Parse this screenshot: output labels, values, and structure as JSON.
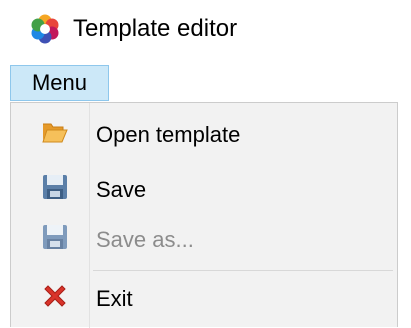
{
  "window": {
    "title": "Template editor",
    "icon": "colorful-flower-app-icon"
  },
  "menubar": {
    "menu_label": "Menu"
  },
  "menu": {
    "items": [
      {
        "label": "Open template",
        "icon": "open-folder-icon",
        "enabled": true
      },
      {
        "label": "Save",
        "icon": "floppy-disk-icon",
        "enabled": true
      },
      {
        "label": "Save as...",
        "icon": "floppy-disk-icon",
        "enabled": false
      },
      {
        "label": "Exit",
        "icon": "red-x-icon",
        "enabled": true
      }
    ]
  },
  "colors": {
    "menu_button_highlight": "#cce8f8",
    "menu_button_border": "#8ec7ec",
    "dropdown_background": "#f2f2f2",
    "disabled_text": "#8c8c8c"
  }
}
